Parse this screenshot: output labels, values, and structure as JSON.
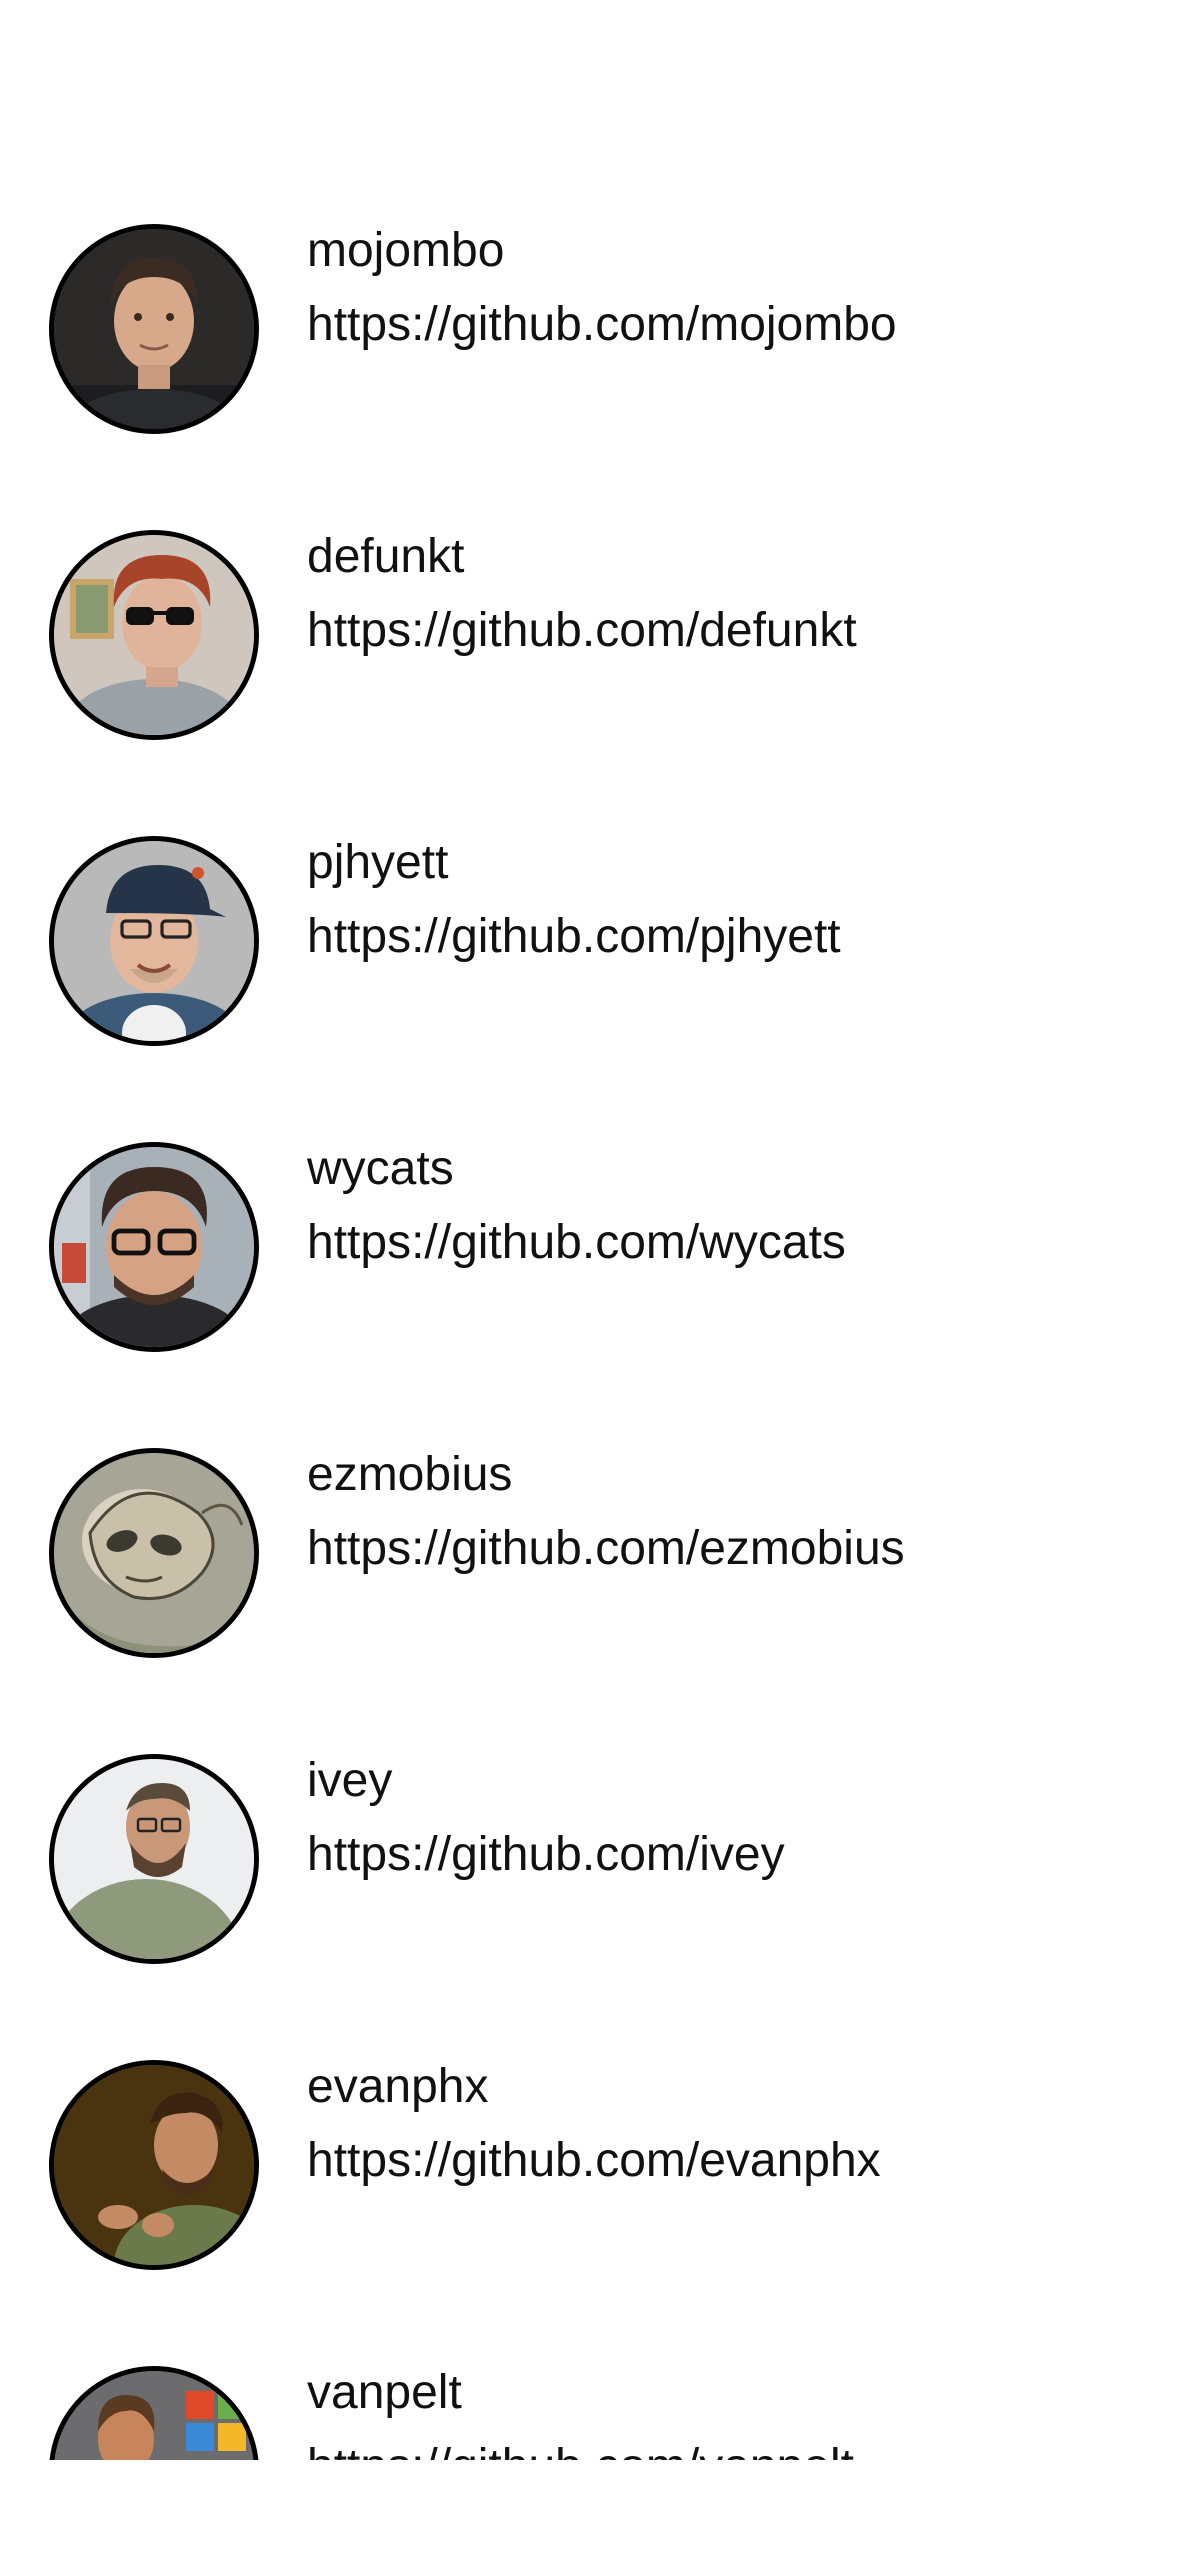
{
  "users": [
    {
      "login": "mojombo",
      "html_url": "https://github.com/mojombo",
      "avatar_icon": "portrait-man-short-hair"
    },
    {
      "login": "defunkt",
      "html_url": "https://github.com/defunkt",
      "avatar_icon": "portrait-redhead-sunglasses"
    },
    {
      "login": "pjhyett",
      "html_url": "https://github.com/pjhyett",
      "avatar_icon": "portrait-man-cap-glasses"
    },
    {
      "login": "wycats",
      "html_url": "https://github.com/wycats",
      "avatar_icon": "portrait-man-glasses-beard"
    },
    {
      "login": "ezmobius",
      "html_url": "https://github.com/ezmobius",
      "avatar_icon": "alien-sketch"
    },
    {
      "login": "ivey",
      "html_url": "https://github.com/ivey",
      "avatar_icon": "portrait-man-beard-green-shirt"
    },
    {
      "login": "evanphx",
      "html_url": "https://github.com/evanphx",
      "avatar_icon": "portrait-man-speaking"
    },
    {
      "login": "vanpelt",
      "html_url": "https://github.com/vanpelt",
      "avatar_icon": "portrait-man-colorful"
    }
  ],
  "colors": {
    "background": "#ffffff",
    "text": "#111111",
    "avatar_border": "#000000"
  }
}
